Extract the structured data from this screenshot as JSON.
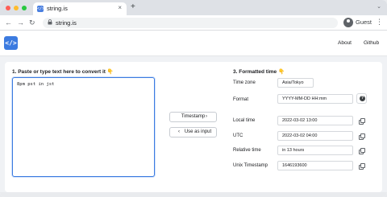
{
  "browser": {
    "tab_title": "string.is",
    "tab_close": "×",
    "new_tab": "+",
    "tab_menu": "⌄",
    "favicon_text": "</>",
    "url": "string.is",
    "profile_name": "Guest",
    "back": "←",
    "forward": "→",
    "reload": "↻",
    "menu": "⋮",
    "lock": "🔒"
  },
  "site": {
    "logo_text": "</>",
    "nav": {
      "about": "About",
      "github": "Github"
    }
  },
  "input_section": {
    "title": "1. Paste or type text here to convert it",
    "title_icon": "👇",
    "value": "8pm pst in jst"
  },
  "actions": {
    "timestamp_label": "Timestamp",
    "timestamp_arrow": "›",
    "use_as_input_label": "Use as input",
    "use_as_input_arrow": "‹"
  },
  "output_section": {
    "title": "3. Formatted time",
    "title_icon": "👇",
    "rows": {
      "timezone": {
        "label": "Time zone",
        "value": "Asia/Tokyo"
      },
      "format": {
        "label": "Format",
        "value": "YYYY-MM-DD HH:mm"
      },
      "local_time": {
        "label": "Local time",
        "value": "2022-03-02 13:00"
      },
      "utc": {
        "label": "UTC",
        "value": "2022-03-02 04:00"
      },
      "relative_time": {
        "label": "Relative time",
        "value": "in 13 hours"
      },
      "unix_timestamp": {
        "label": "Unix Timestamp",
        "value": "1646193600"
      }
    },
    "help_glyph": "?"
  },
  "colors": {
    "accent": "#3c7be0",
    "hand": "#f2a427"
  }
}
